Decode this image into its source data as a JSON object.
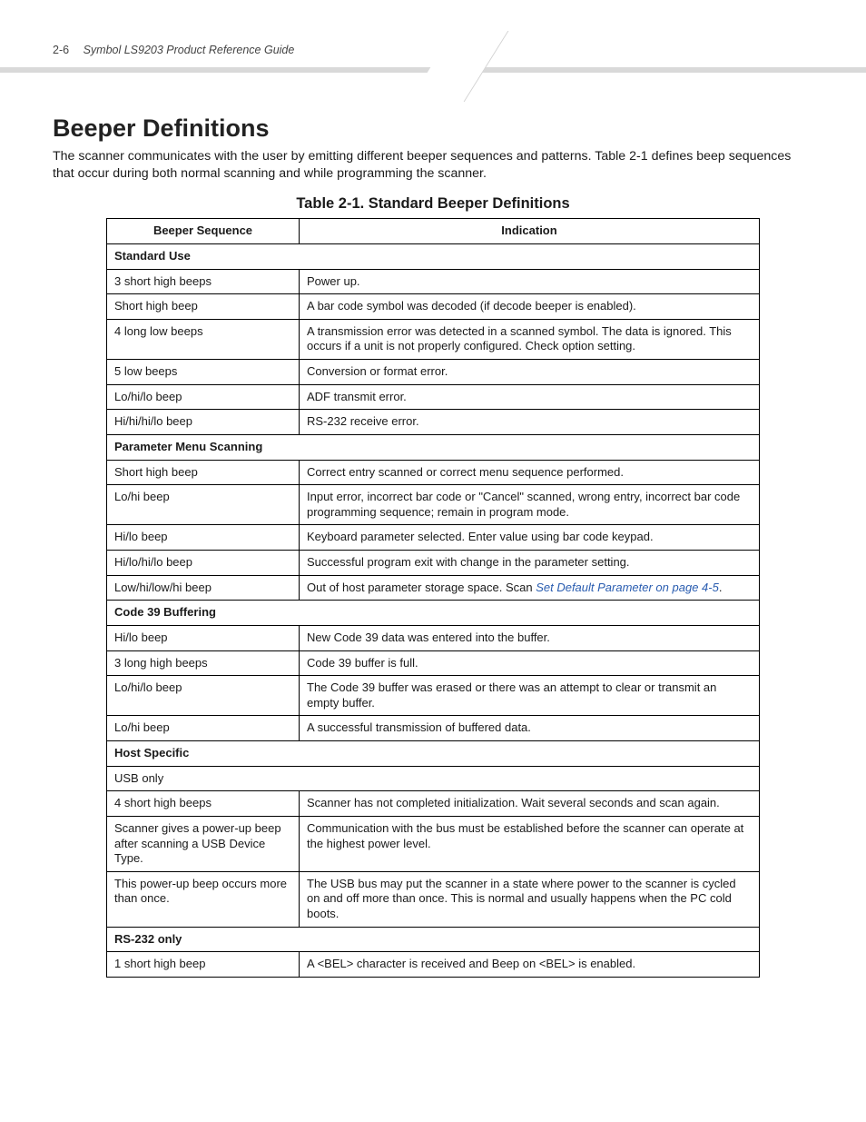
{
  "header": {
    "page_num": "2-6",
    "doc_title": "Symbol LS9203 Product Reference Guide"
  },
  "section": {
    "title": "Beeper Definitions",
    "intro": "The scanner communicates with the user by emitting different beeper sequences and patterns. Table 2-1 defines beep sequences that occur during both normal scanning and while programming the scanner."
  },
  "table": {
    "caption": "Table 2-1. Standard Beeper Definitions",
    "columns": {
      "seq": "Beeper Sequence",
      "ind": "Indication"
    },
    "groups": [
      {
        "heading": "Standard Use",
        "rows": [
          {
            "seq": "3 short high beeps",
            "ind": "Power up."
          },
          {
            "seq": "Short high beep",
            "ind": "A bar code symbol was decoded (if decode beeper is enabled)."
          },
          {
            "seq": "4 long low beeps",
            "ind": "A transmission error was detected in a scanned symbol. The data is ignored. This occurs if a unit is not properly configured. Check option setting."
          },
          {
            "seq": "5 low beeps",
            "ind": "Conversion or format error."
          },
          {
            "seq": "Lo/hi/lo beep",
            "ind": "ADF transmit error."
          },
          {
            "seq": "Hi/hi/hi/lo beep",
            "ind": "RS-232 receive error."
          }
        ]
      },
      {
        "heading": "Parameter Menu Scanning",
        "rows": [
          {
            "seq": "Short high beep",
            "ind": "Correct entry scanned or correct menu sequence performed."
          },
          {
            "seq": "Lo/hi beep",
            "ind": "Input error, incorrect bar code or \"Cancel\" scanned, wrong entry, incorrect bar code programming sequence; remain in program mode."
          },
          {
            "seq": "Hi/lo beep",
            "ind": "Keyboard parameter selected. Enter value using bar code keypad."
          },
          {
            "seq": "Hi/lo/hi/lo beep",
            "ind": "Successful program exit with change in the parameter setting."
          },
          {
            "seq": "Low/hi/low/hi beep",
            "ind_pre": "Out of host parameter storage space. Scan ",
            "xref": "Set Default Parameter on page 4-5",
            "ind_post": "."
          }
        ]
      },
      {
        "heading": "Code 39 Buffering",
        "rows": [
          {
            "seq": "Hi/lo beep",
            "ind": "New Code 39 data was entered into the buffer."
          },
          {
            "seq": "3 long high beeps",
            "ind": "Code 39 buffer is full."
          },
          {
            "seq": "Lo/hi/lo beep",
            "ind": "The Code 39 buffer was erased or there was an attempt to clear or transmit an empty buffer."
          },
          {
            "seq": "Lo/hi beep",
            "ind": "A successful transmission of buffered data."
          }
        ]
      },
      {
        "heading": "Host Specific",
        "rows": [
          {
            "seq": "USB only",
            "ind": ""
          },
          {
            "seq": "4 short high beeps",
            "ind": "Scanner has not completed initialization. Wait several seconds and scan again."
          },
          {
            "seq": "Scanner gives a power-up beep after scanning a USB Device Type.",
            "ind": "Communication with the bus must be established before the scanner can operate at the highest power level."
          },
          {
            "seq": "This power-up beep occurs more than once.",
            "ind": "The USB bus may put the scanner in a state where power to the scanner is cycled on and off more than once. This is normal and usually happens when the PC cold boots."
          }
        ]
      },
      {
        "heading": "RS-232 only",
        "rows": [
          {
            "seq": "1 short high beep",
            "ind": "A <BEL> character is received and Beep on <BEL> is enabled."
          }
        ]
      }
    ]
  }
}
